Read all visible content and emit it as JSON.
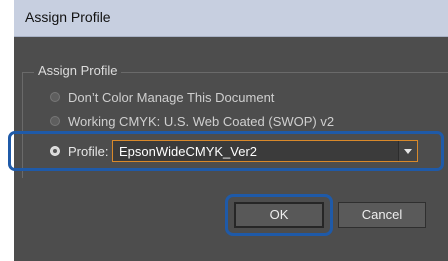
{
  "window": {
    "title": "Assign Profile"
  },
  "group": {
    "title": "Assign Profile"
  },
  "options": [
    {
      "label": "Don’t Color Manage This Document",
      "selected": false
    },
    {
      "label": "Working CMYK: U.S. Web Coated (SWOP) v2",
      "selected": false
    },
    {
      "label": "Profile:",
      "selected": true
    }
  ],
  "profile_select": {
    "value": "EpsonWideCMYK_Ver2"
  },
  "buttons": {
    "ok": "OK",
    "cancel": "Cancel"
  },
  "colors": {
    "highlight": "#1f5aa8",
    "focus": "#d9892a",
    "background": "#4d4d4d"
  }
}
